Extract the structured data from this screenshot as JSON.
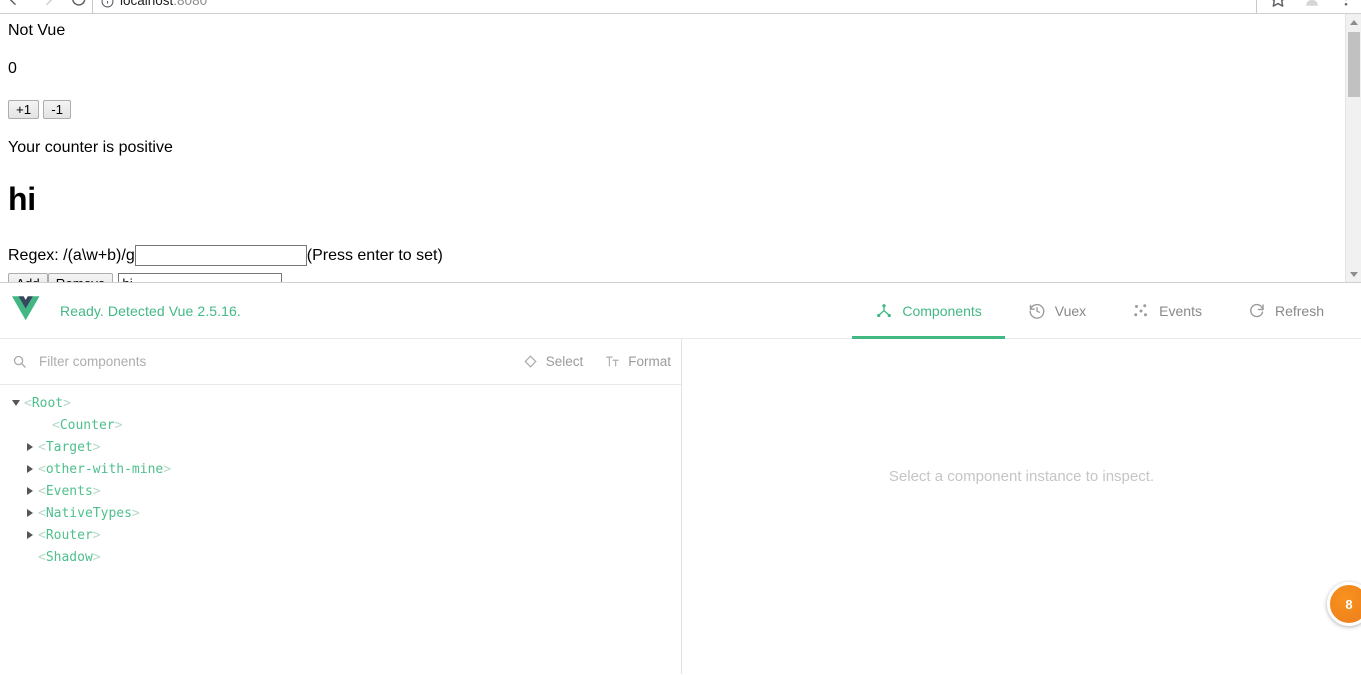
{
  "browser": {
    "url_host": "localhost",
    "url_port": ":8080",
    "back_label": "Back",
    "forward_label": "Forward",
    "reload_label": "Reload",
    "bookmark_label": "Bookmark this page",
    "profile_label": "Profile",
    "menu_label": "Customize and control"
  },
  "page": {
    "title": "Not Vue",
    "counter_value": "0",
    "increment_label": "+1",
    "decrement_label": "-1",
    "status_text": "Your counter is positive",
    "heading": "hi",
    "regex_label": "Regex: /(a\\w+b)/g",
    "regex_value": "",
    "regex_placeholder": "",
    "regex_hint": "(Press enter to set)",
    "add_label": "Add",
    "remove_label": "Remove",
    "word_value": "hi"
  },
  "devtools": {
    "status": "Ready. Detected Vue 2.5.16.",
    "logo_name": "vue-logo",
    "accent_color": "#42b983",
    "tabs": [
      {
        "label": "Components",
        "icon": "components-icon",
        "active": true
      },
      {
        "label": "Vuex",
        "icon": "vuex-history-icon",
        "active": false
      },
      {
        "label": "Events",
        "icon": "events-icon",
        "active": false
      },
      {
        "label": "Refresh",
        "icon": "refresh-icon",
        "active": false
      }
    ],
    "toolbar": {
      "filter_placeholder": "Filter components",
      "filter_value": "",
      "search_icon": "search-icon",
      "select_label": "Select",
      "select_icon": "target-icon",
      "format_label": "Format",
      "format_icon": "text-format-icon"
    },
    "tree": [
      {
        "name": "Root",
        "depth": 0,
        "arrow": "open"
      },
      {
        "name": "Counter",
        "depth": 2,
        "arrow": "none"
      },
      {
        "name": "Target",
        "depth": 1,
        "arrow": "closed"
      },
      {
        "name": "other-with-mine",
        "depth": 1,
        "arrow": "closed"
      },
      {
        "name": "Events",
        "depth": 1,
        "arrow": "closed"
      },
      {
        "name": "NativeTypes",
        "depth": 1,
        "arrow": "closed"
      },
      {
        "name": "Router",
        "depth": 1,
        "arrow": "closed"
      },
      {
        "name": "Shadow",
        "depth": 1,
        "arrow": "none"
      }
    ],
    "inspect_empty_text": "Select a component instance to inspect.",
    "float_badge_label": "8"
  }
}
